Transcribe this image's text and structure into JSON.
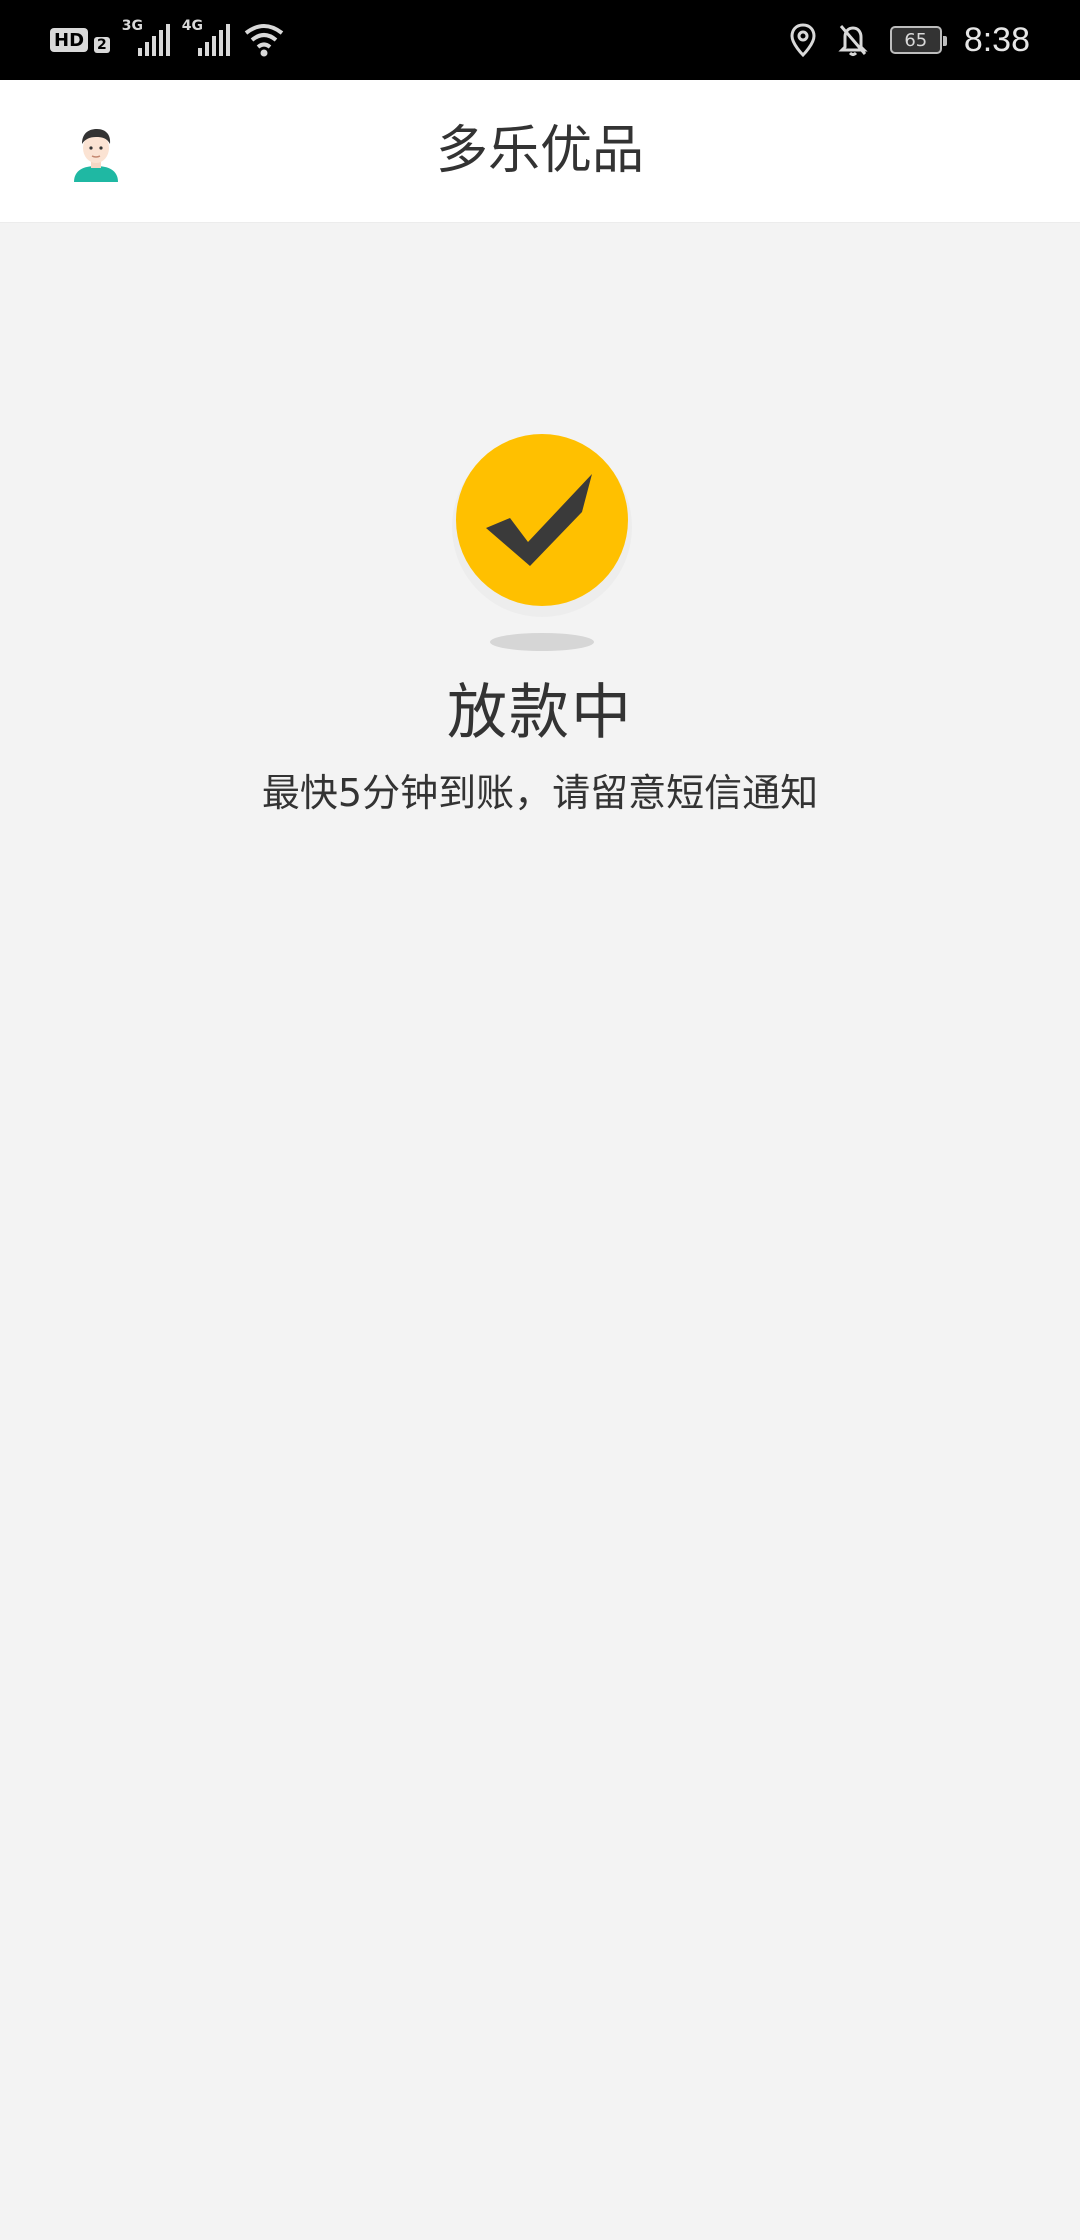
{
  "status_bar": {
    "hd_label": "HD",
    "sim_label": "2",
    "network_1": "3G",
    "network_2": "4G",
    "battery_level": "65",
    "time": "8:38",
    "icons": [
      "hd-icon",
      "signal-icon",
      "wifi-icon",
      "location-icon",
      "bell-off-icon",
      "battery-icon"
    ]
  },
  "header": {
    "title": "多乐优品",
    "avatar_icon": "user-avatar-icon"
  },
  "status": {
    "icon": "check-circle-icon",
    "accent_color": "#ffc000",
    "title": "放款中",
    "subtitle": "最快5分钟到账，请留意短信通知"
  }
}
